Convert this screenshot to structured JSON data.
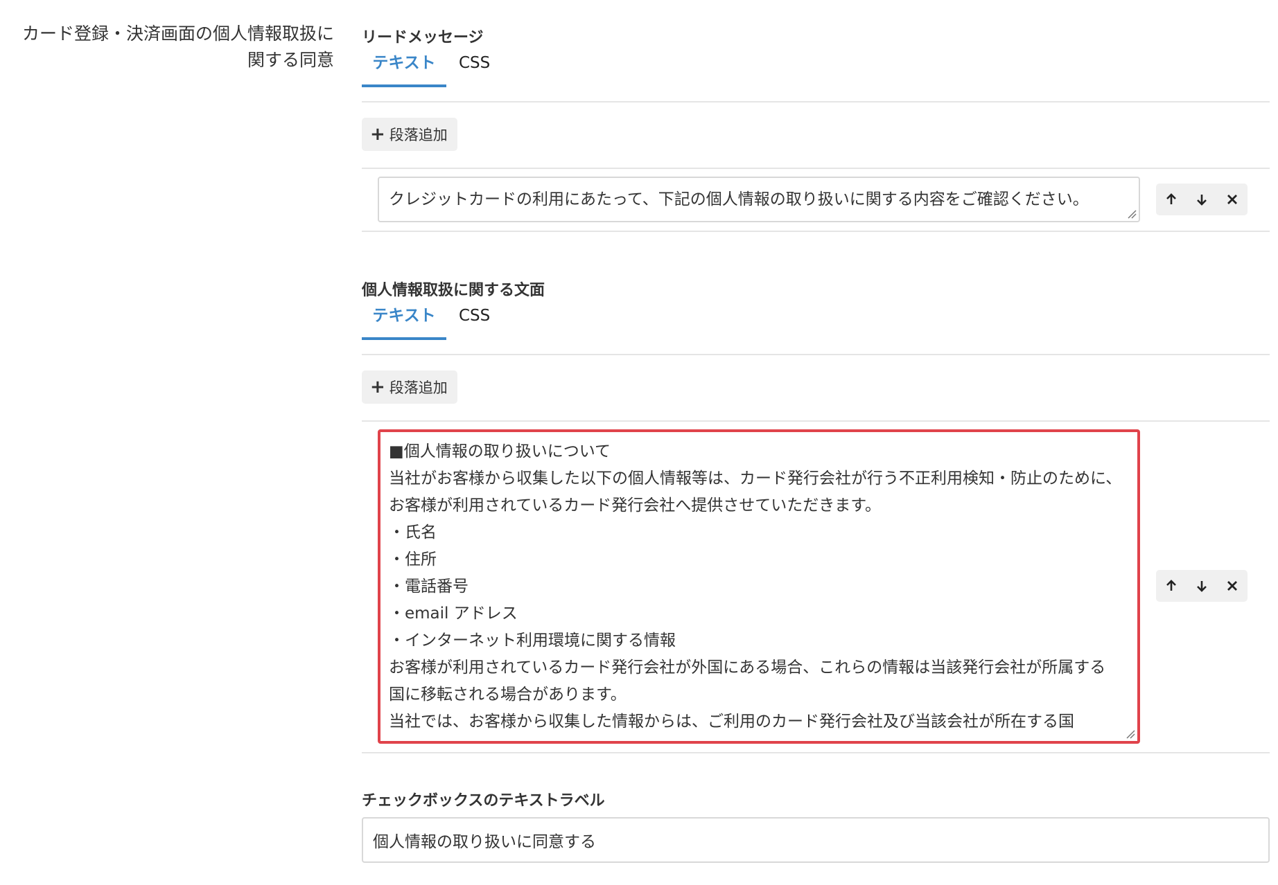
{
  "row_label": {
    "line1": "カード登録・決済画面の個人情報取扱に",
    "line2": "関する同意"
  },
  "lead": {
    "title": "リードメッセージ",
    "tabs": [
      {
        "label": "テキスト",
        "active": true
      },
      {
        "label": "CSS",
        "active": false
      }
    ],
    "add_label": "段落追加",
    "paragraph": "クレジットカードの利用にあたって、下記の個人情報の取り扱いに関する内容をご確認ください。"
  },
  "privacy": {
    "title": "個人情報取扱に関する文面",
    "tabs": [
      {
        "label": "テキスト",
        "active": true
      },
      {
        "label": "CSS",
        "active": false
      }
    ],
    "add_label": "段落追加",
    "paragraph": "■個人情報の取り扱いについて\n当社がお客様から収集した以下の個人情報等は、カード発行会社が行う不正利用検知・防止のために、お客様が利用されているカード発行会社へ提供させていただきます。\n・氏名\n・住所\n・電話番号\n・email アドレス\n・インターネット利用環境に関する情報\nお客様が利用されているカード発行会社が外国にある場合、これらの情報は当該発行会社が所属する\n国に移転される場合があります。\n当社では、お客様から収集した情報からは、ご利用のカード発行会社及び当該会社が所在する国"
  },
  "checkbox_label": {
    "title": "チェックボックスのテキストラベル",
    "value": "個人情報の取り扱いに同意する"
  },
  "icons": {
    "move_up": "arrow-up-icon",
    "move_down": "arrow-down-icon",
    "delete": "close-icon",
    "add": "plus-icon"
  },
  "colors": {
    "accent": "#3a86c8",
    "highlight": "#e0434b"
  }
}
